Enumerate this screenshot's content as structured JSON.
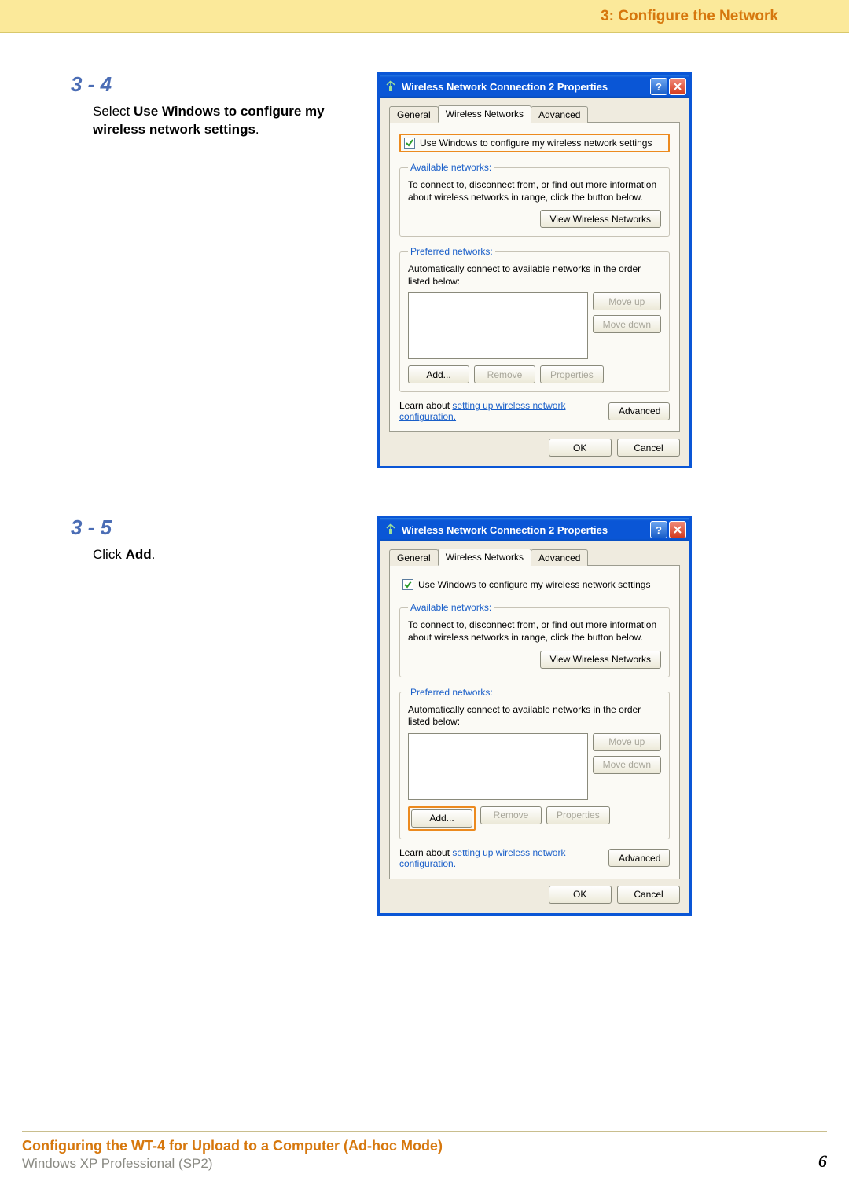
{
  "header": {
    "section_title": "3: Configure the Network"
  },
  "steps": [
    {
      "num": "3 - 4",
      "text_parts": [
        "Select ",
        "Use Windows to configure my wireless network settings",
        "."
      ]
    },
    {
      "num": "3 - 5",
      "text_parts": [
        "Click ",
        "Add",
        "."
      ]
    }
  ],
  "dialog": {
    "title": "Wireless Network Connection 2 Properties",
    "tabs": [
      "General",
      "Wireless Networks",
      "Advanced"
    ],
    "active_tab": 1,
    "checkbox_label": "Use Windows to configure my wireless network settings",
    "available": {
      "legend": "Available networks:",
      "desc": "To connect to, disconnect from, or find out more information about wireless networks in range, click the button below.",
      "button": "View Wireless Networks"
    },
    "preferred": {
      "legend": "Preferred networks:",
      "desc": "Automatically connect to available networks in the order listed below:",
      "move_up": "Move up",
      "move_down": "Move down",
      "add": "Add...",
      "remove": "Remove",
      "properties": "Properties"
    },
    "learn": {
      "prefix": "Learn about ",
      "link": "setting up wireless network configuration.",
      "button": "Advanced"
    },
    "ok": "OK",
    "cancel": "Cancel"
  },
  "footer": {
    "title": "Configuring the WT-4 for Upload to a Computer (Ad-hoc Mode)",
    "sub": "Windows XP Professional (SP2)",
    "page": "6"
  }
}
